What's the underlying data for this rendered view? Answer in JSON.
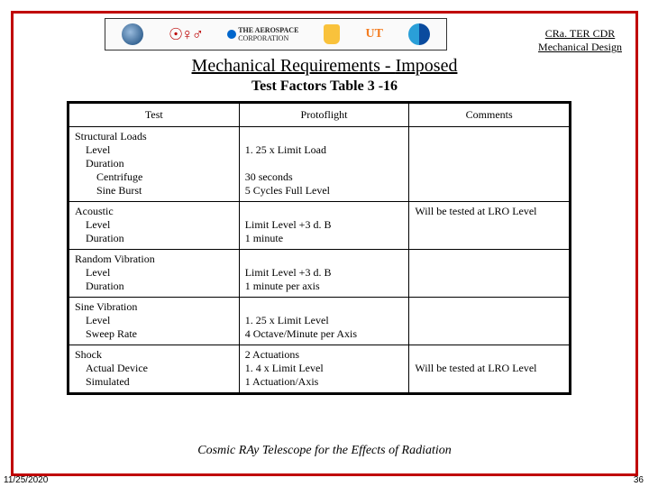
{
  "header": {
    "doc_ref_line1": "CRa. TER CDR",
    "doc_ref_line2": "Mechanical Design"
  },
  "title": {
    "left": "Mechanical Requirements - ",
    "right": "Imposed",
    "subtitle": "Test Factors Table 3 -16"
  },
  "table": {
    "headers": {
      "test": "Test",
      "protoflight": "Protoflight",
      "comments": "Comments"
    },
    "rows": [
      {
        "test": {
          "main": "Structural Loads",
          "sub": [
            "Level",
            "Duration"
          ],
          "subsub": [
            "Centrifuge",
            "Sine Burst"
          ]
        },
        "proto": [
          "1. 25 x Limit Load",
          "",
          "30 seconds",
          "5 Cycles Full Level"
        ],
        "comments": ""
      },
      {
        "test": {
          "main": "Acoustic",
          "sub": [
            "Level",
            "Duration"
          ],
          "subsub": []
        },
        "proto": [
          "",
          "Limit Level +3 d. B",
          "1 minute"
        ],
        "comments": "Will be tested at LRO Level"
      },
      {
        "test": {
          "main": "Random Vibration",
          "sub": [
            "Level",
            "Duration"
          ],
          "subsub": []
        },
        "proto": [
          "",
          "Limit Level +3 d. B",
          "1 minute per axis"
        ],
        "comments": ""
      },
      {
        "test": {
          "main": "Sine Vibration",
          "sub": [
            "Level",
            "Sweep Rate"
          ],
          "subsub": []
        },
        "proto": [
          "",
          "1. 25 x Limit Level",
          "4 Octave/Minute per Axis"
        ],
        "comments": ""
      },
      {
        "test": {
          "main": "Shock",
          "sub": [
            "Actual Device",
            "Simulated"
          ],
          "subsub": []
        },
        "proto": [
          "2 Actuations",
          "1. 4 x Limit Level",
          "1 Actuation/Axis"
        ],
        "comments": "Will be tested at LRO Level"
      }
    ]
  },
  "tagline": {
    "c": "C",
    "osmic": "osmic ",
    "ra": "RA",
    "y": "y ",
    "t": "T",
    "elescope": "elescope for the ",
    "e": "E",
    "ffects": "ffects of ",
    "r": "R",
    "adiation": "adiation"
  },
  "footer": {
    "date": "11/25/2020",
    "page": "36"
  },
  "logos": {
    "aero_text": "THE AEROSPACE",
    "aero_text2": "CORPORATION",
    "ut": "UT"
  }
}
